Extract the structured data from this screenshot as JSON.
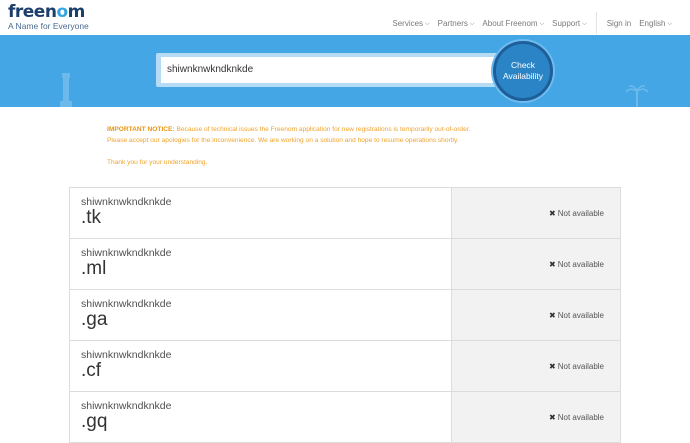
{
  "brand": {
    "logo_part1": "freen",
    "logo_o": "o",
    "logo_part2": "m",
    "tagline": "A Name for Everyone"
  },
  "nav": {
    "services": "Services",
    "partners": "Partners",
    "about": "About Freenom",
    "support": "Support",
    "signin": "Sign in",
    "language": "English"
  },
  "search": {
    "value": "shiwnknwkndknkde",
    "button_line1": "Check",
    "button_line2": "Availability"
  },
  "notice": {
    "heading": "IMPORTANT NOTICE:",
    "text1": " Because of technical issues the Freenom application for new registrations is temporarily out-of-order.",
    "text2": "Please accept our apologies for the inconvenience. We are working on a solution and hope to resume operations shortly.",
    "text3": "Thank you for your understanding."
  },
  "results": [
    {
      "name": "shiwnknwkndknkde",
      "tld": ".tk",
      "status": "Not available"
    },
    {
      "name": "shiwnknwkndknkde",
      "tld": ".ml",
      "status": "Not available"
    },
    {
      "name": "shiwnknwkndknkde",
      "tld": ".ga",
      "status": "Not available"
    },
    {
      "name": "shiwnknwkndknkde",
      "tld": ".cf",
      "status": "Not available"
    },
    {
      "name": "shiwnknwkndknkde",
      "tld": ".gq",
      "status": "Not available"
    }
  ],
  "colors": {
    "hero_bg": "#45a6e6",
    "button_bg": "#2b84c6",
    "notice_text": "#f0a32c",
    "logo_dark": "#1c3e6b",
    "logo_accent": "#34a6dd"
  },
  "icons": {
    "chevron": "chevron-down-icon",
    "status": "close-icon"
  }
}
